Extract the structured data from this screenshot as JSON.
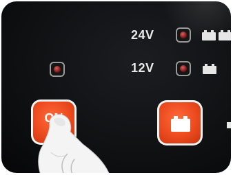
{
  "indicators": {
    "v24_label": "24V",
    "v12_label": "12V"
  },
  "buttons": {
    "on_label": "ON"
  },
  "colors": {
    "panel": "#0f1012",
    "button_orange": "#ec4a1e",
    "led_red": "#8a1f1f",
    "label_white": "#e9e9e9"
  },
  "icons": [
    "battery-icon",
    "led-indicator",
    "finger-pressing"
  ]
}
